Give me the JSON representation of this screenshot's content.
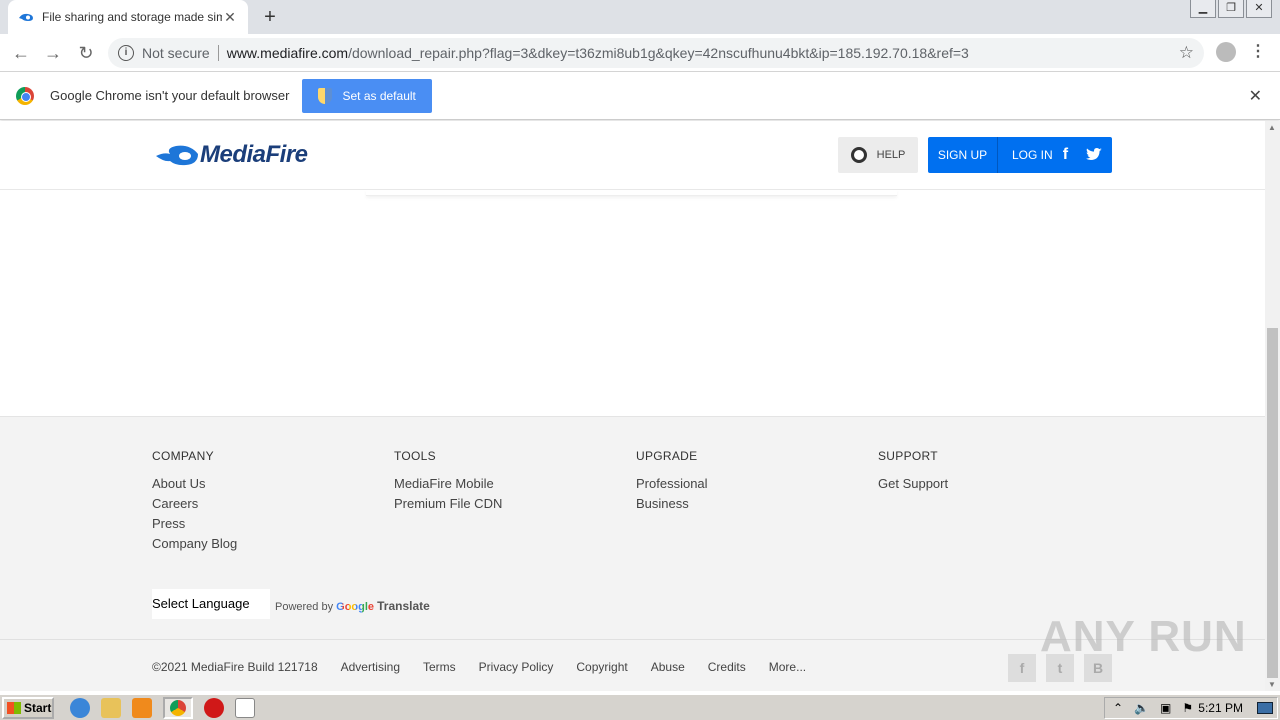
{
  "browser": {
    "tab_title": "File sharing and storage made simple",
    "url_security": "Not secure",
    "url_host": "www.mediafire.com",
    "url_path": "/download_repair.php?flag=3&dkey=t36zmi8ub1g&qkey=42nscufhunu4bkt&ip=185.192.70.18&ref=3"
  },
  "infobar": {
    "message": "Google Chrome isn't your default browser",
    "button_label": "Set as default"
  },
  "header": {
    "logo_text": "MediaFire",
    "help_label": "HELP",
    "signup_label": "SIGN UP",
    "login_label": "LOG IN"
  },
  "footer": {
    "columns": [
      {
        "heading": "COMPANY",
        "links": [
          "About Us",
          "Careers",
          "Press",
          "Company Blog"
        ]
      },
      {
        "heading": "TOOLS",
        "links": [
          "MediaFire Mobile",
          "Premium File CDN"
        ]
      },
      {
        "heading": "UPGRADE",
        "links": [
          "Professional",
          "Business"
        ]
      },
      {
        "heading": "SUPPORT",
        "links": [
          "Get Support"
        ]
      }
    ],
    "language_select": "Select Language",
    "powered_by": "Powered by",
    "google": "Google",
    "translate": "Translate",
    "copyright": "©2021 MediaFire Build 121718",
    "bottom_links": [
      "Advertising",
      "Terms",
      "Privacy Policy",
      "Copyright",
      "Abuse",
      "Credits",
      "More..."
    ]
  },
  "watermark": "ANY RUN",
  "taskbar": {
    "start_label": "Start",
    "clock": "5:21 PM"
  },
  "colors": {
    "accent_blue": "#0070f0",
    "mediafire_navy": "#1b3e7a",
    "infobar_button": "#4a8ef3"
  }
}
